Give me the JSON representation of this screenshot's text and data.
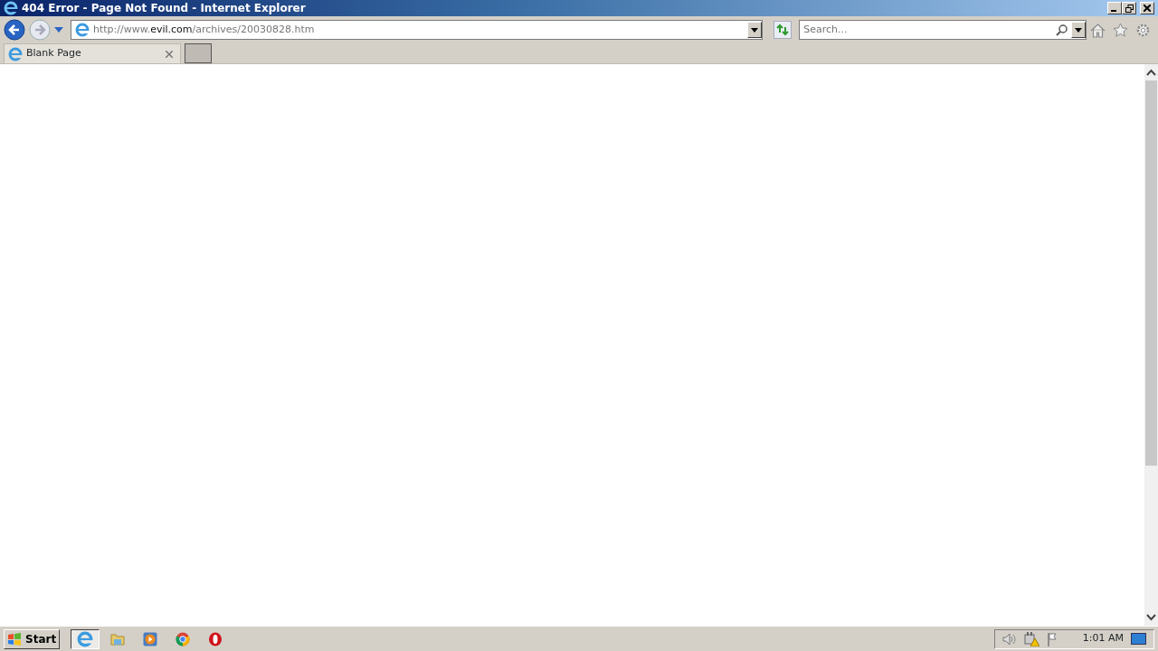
{
  "window": {
    "title": "404 Error - Page Not Found - Internet Explorer"
  },
  "address_bar": {
    "url": [
      {
        "text": "http://www.",
        "emphasized": false
      },
      {
        "text": "evil.com",
        "emphasized": true
      },
      {
        "text": "/archives/20030828.htm",
        "emphasized": false
      }
    ]
  },
  "search": {
    "placeholder": "Search..."
  },
  "tabs": [
    {
      "label": "Blank Page",
      "selected": true
    }
  ],
  "taskbar": {
    "start": "Start",
    "apps": [
      {
        "kind": "ie",
        "selected": true
      },
      {
        "kind": "folder",
        "selected": false
      },
      {
        "kind": "media",
        "selected": false
      },
      {
        "kind": "chrome",
        "selected": false
      },
      {
        "kind": "opera",
        "selected": false
      }
    ],
    "clock": "1:01 AM"
  }
}
